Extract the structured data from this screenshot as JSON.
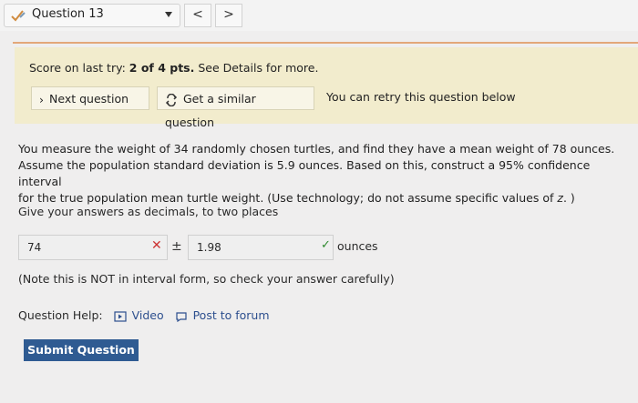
{
  "top": {
    "question_label": "Question 13",
    "prev_icon": "<",
    "next_icon": ">"
  },
  "score": {
    "line_prefix": "Score on last try: ",
    "score_value": "2 of 4 pts.",
    "line_suffix": " See Details for more.",
    "next_button": "Next question",
    "similar_button": "Get a similar question",
    "retry_text": "You can retry this question below"
  },
  "question": {
    "text_1": "You measure the weight of 34 randomly chosen turtles, and find they have a mean weight of 78 ounces.",
    "text_2": "Assume the population standard deviation is 5.9 ounces. Based on this, construct a 95% confidence interval",
    "text_3": "for the true population mean turtle weight. (Use technology; do not assume specific values of ",
    "text_var": "z",
    "text_end": ". )",
    "instruction": "Give your answers as decimals, to two places",
    "answer_1": "74",
    "plus_minus": "±",
    "answer_2": "1.98",
    "units": "ounces",
    "note": "(Note this is NOT in interval form, so check your answer carefully)"
  },
  "help": {
    "label": "Question Help:",
    "video": "Video",
    "forum": "Post to forum"
  },
  "submit": "Submit Question"
}
